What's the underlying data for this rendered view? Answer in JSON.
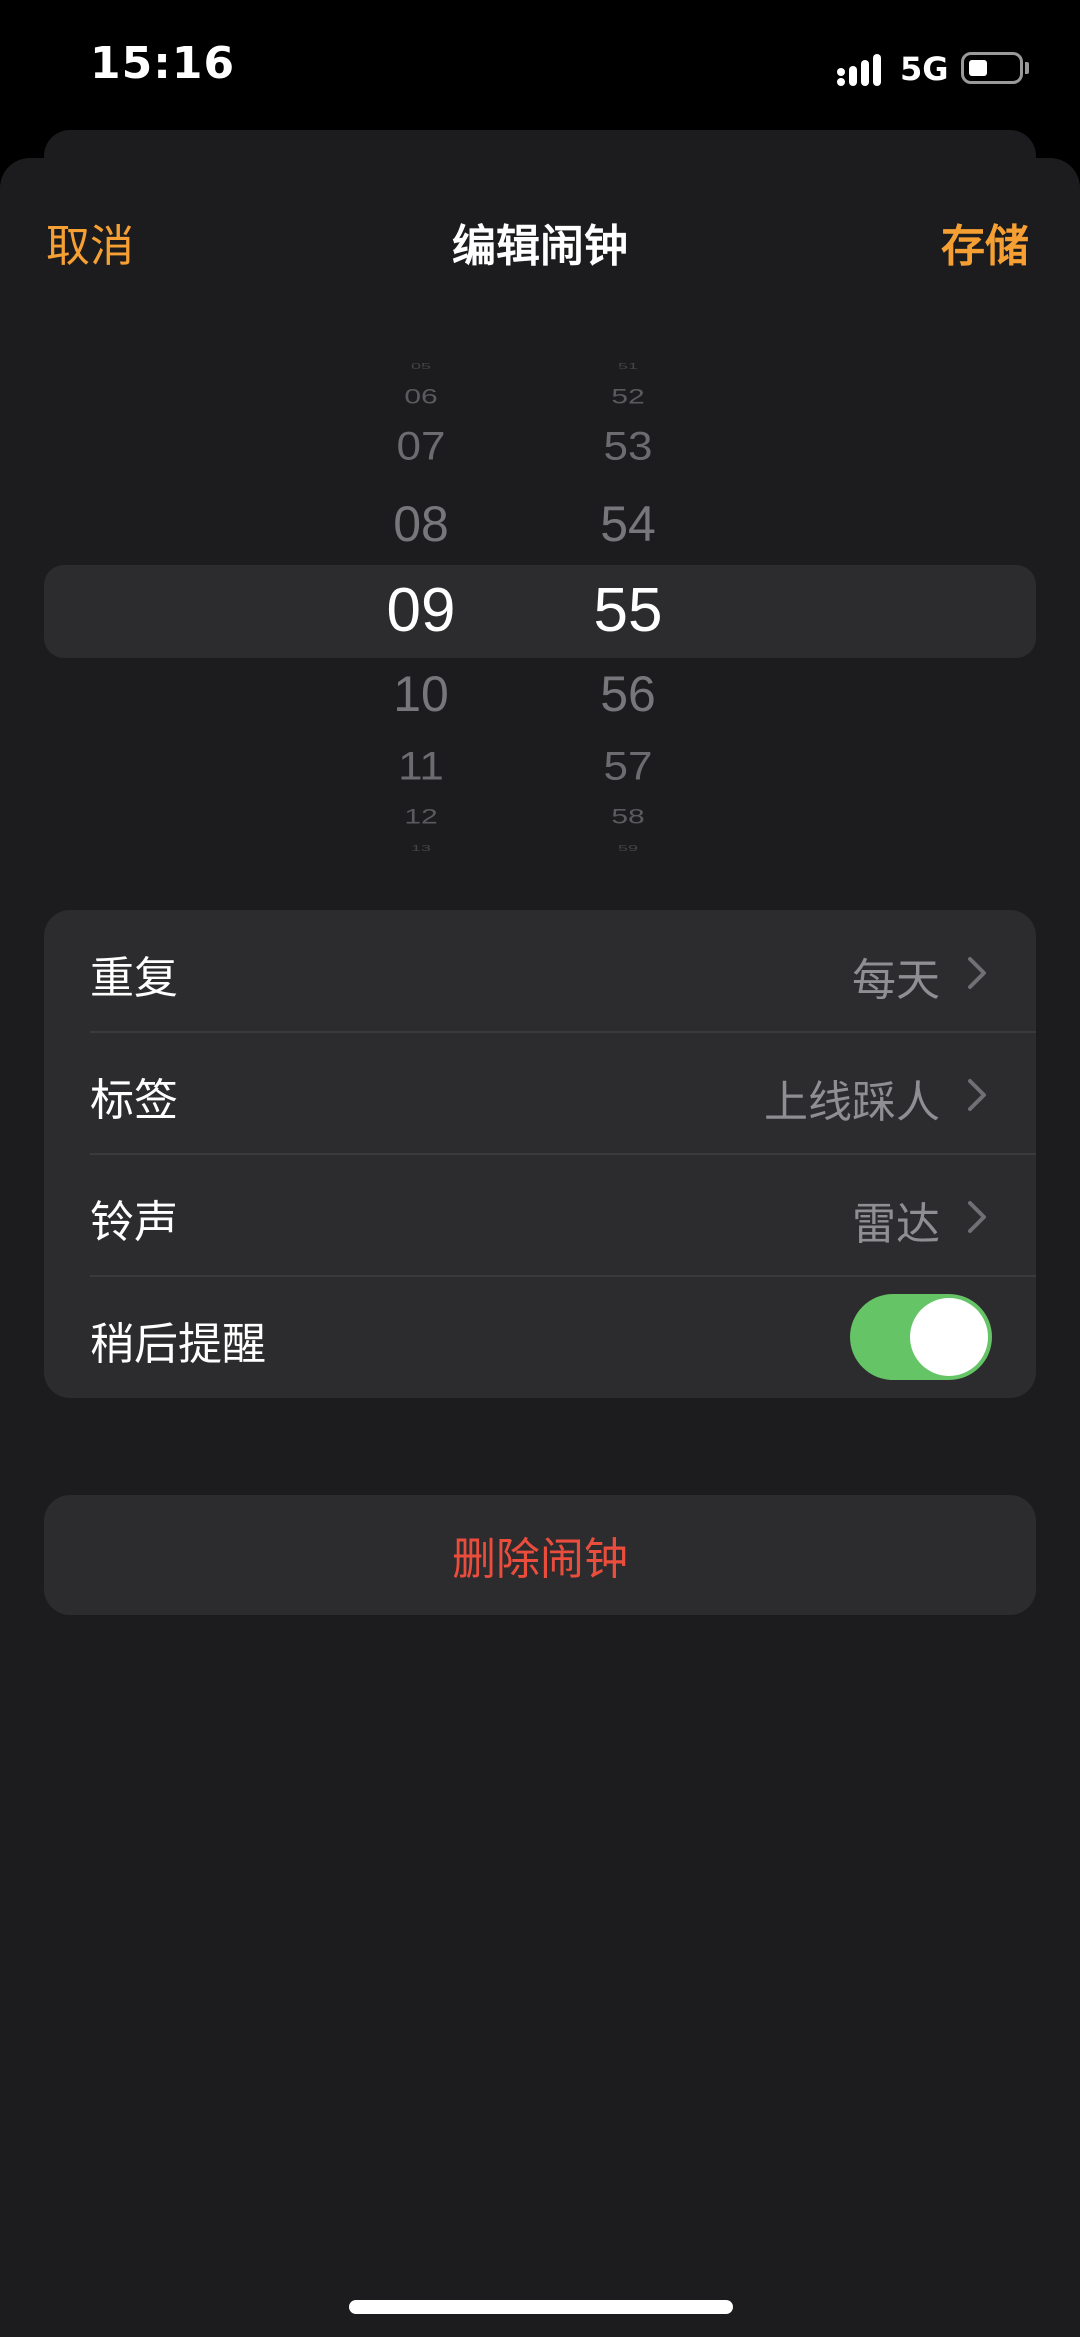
{
  "status_bar": {
    "time": "15:16",
    "network": "5G",
    "battery_level": 0.4
  },
  "nav": {
    "cancel_label": "取消",
    "title": "编辑闹钟",
    "save_label": "存储"
  },
  "picker": {
    "hours": [
      "05",
      "06",
      "07",
      "08",
      "09",
      "10",
      "11",
      "12",
      "13"
    ],
    "minutes": [
      "51",
      "52",
      "53",
      "54",
      "55",
      "56",
      "57",
      "58",
      "59"
    ],
    "selected_hour": "09",
    "selected_minute": "55"
  },
  "settings": {
    "repeat": {
      "label": "重复",
      "value": "每天"
    },
    "tag": {
      "label": "标签",
      "value": "上线踩人"
    },
    "sound": {
      "label": "铃声",
      "value": "雷达"
    },
    "snooze": {
      "label": "稍后提醒",
      "enabled": true
    }
  },
  "delete_label": "删除闹钟",
  "colors": {
    "accent": "#f6a034",
    "toggle_on": "#65c466",
    "destructive": "#eb4d3d"
  }
}
